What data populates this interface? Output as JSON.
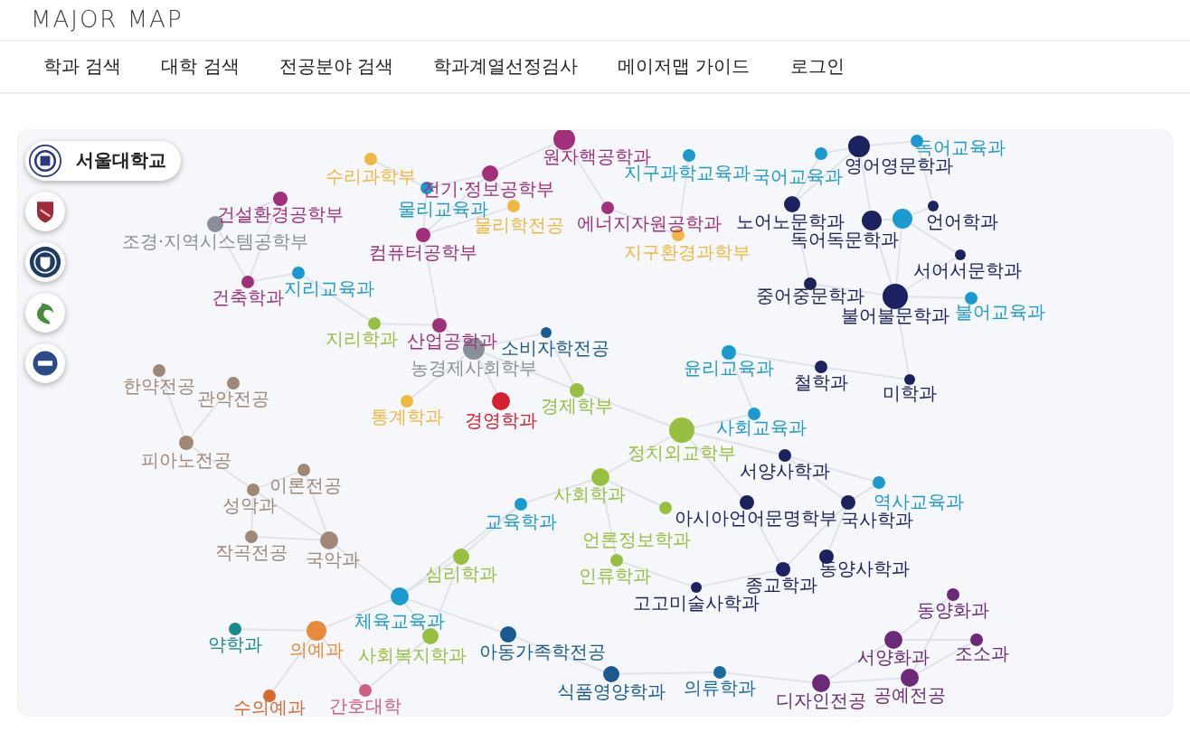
{
  "header": {
    "title": "MAJOR MAP"
  },
  "nav": [
    {
      "label": "학과 검색"
    },
    {
      "label": "대학 검색"
    },
    {
      "label": "전공분야 검색"
    },
    {
      "label": "학과계열선정검사"
    },
    {
      "label": "메이저맵 가이드"
    },
    {
      "label": "로그인"
    }
  ],
  "universities": [
    {
      "name": "서울대학교",
      "selected": true
    },
    {
      "selected": false
    },
    {
      "selected": false
    },
    {
      "selected": false
    },
    {
      "selected": false
    }
  ],
  "nodes": [
    {
      "label": "수리과학부",
      "color": "#f0b840"
    },
    {
      "label": "원자핵공학과",
      "color": "#a0307a"
    },
    {
      "label": "전기·정보공학부",
      "color": "#a0307a"
    },
    {
      "label": "물리교육과",
      "color": "#1a9ad0"
    },
    {
      "label": "물리학전공",
      "color": "#f0b840"
    },
    {
      "label": "지구과학교육과",
      "color": "#1a9ad0"
    },
    {
      "label": "에너지자원공학과",
      "color": "#a0307a"
    },
    {
      "label": "국어교육과",
      "color": "#1a9ad0"
    },
    {
      "label": "독어교육과",
      "color": "#1a9ad0"
    },
    {
      "label": "영어영문학과",
      "color": "#1c2260"
    },
    {
      "label": "건설환경공학부",
      "color": "#a0307a"
    },
    {
      "label": "조경·지역시스템공학부",
      "color": "#8a9098"
    },
    {
      "label": "컴퓨터공학부",
      "color": "#a0307a"
    },
    {
      "label": "지구환경과학부",
      "color": "#f0b840"
    },
    {
      "label": "노어노문학과",
      "color": "#1c2260"
    },
    {
      "label": "독어독문학과",
      "color": "#1c2260"
    },
    {
      "color": "#1a9ad0"
    },
    {
      "label": "언어학과",
      "color": "#1c2260"
    },
    {
      "label": "건축학과",
      "color": "#a0307a"
    },
    {
      "label": "지리교육과",
      "color": "#1a9ad0"
    },
    {
      "label": "서어서문학과",
      "color": "#1c2260"
    },
    {
      "label": "중어중문학과",
      "color": "#1c2260"
    },
    {
      "label": "불어불문학과",
      "color": "#1c2260"
    },
    {
      "label": "불어교육과",
      "color": "#1a9ad0"
    },
    {
      "label": "지리학과",
      "color": "#98c040"
    },
    {
      "label": "산업공학과",
      "color": "#a0307a"
    },
    {
      "label": "농경제사회학부",
      "color": "#8a9098"
    },
    {
      "label": "소비자학전공",
      "color": "#1a5a90"
    },
    {
      "label": "윤리교육과",
      "color": "#1a9ad0"
    },
    {
      "label": "철학과",
      "color": "#1c2260"
    },
    {
      "label": "미학과",
      "color": "#1c2260"
    },
    {
      "label": "한약전공",
      "color": "#a08878"
    },
    {
      "label": "관악전공",
      "color": "#a08878"
    },
    {
      "label": "통계학과",
      "color": "#f0b840"
    },
    {
      "label": "경영학과",
      "color": "#d42030"
    },
    {
      "label": "경제학부",
      "color": "#98c040"
    },
    {
      "label": "사회교육과",
      "color": "#1a9ad0"
    },
    {
      "label": "정치외교학부",
      "color": "#98c040"
    },
    {
      "label": "피아노전공",
      "color": "#a08878"
    },
    {
      "label": "서양사학과",
      "color": "#1c2260"
    },
    {
      "label": "이론전공",
      "color": "#a08878"
    },
    {
      "label": "성악과",
      "color": "#a08878"
    },
    {
      "label": "사회학과",
      "color": "#98c040"
    },
    {
      "label": "역사교육과",
      "color": "#1a9ad0"
    },
    {
      "label": "교육학과",
      "color": "#1a9ad0"
    },
    {
      "label": "아시아언어문명학부",
      "color": "#1c2260"
    },
    {
      "label": "국사학과",
      "color": "#1c2260"
    },
    {
      "label": "언론정보학과",
      "color": "#98c040"
    },
    {
      "label": "작곡전공",
      "color": "#a08878"
    },
    {
      "label": "국악과",
      "color": "#a08878"
    },
    {
      "label": "심리학과",
      "color": "#98c040"
    },
    {
      "label": "인류학과",
      "color": "#98c040"
    },
    {
      "label": "동양사학과",
      "color": "#1c2260"
    },
    {
      "label": "종교학과",
      "color": "#1c2260"
    },
    {
      "label": "고고미술사학과",
      "color": "#1c2260"
    },
    {
      "label": "체육교육과",
      "color": "#1a9ad0"
    },
    {
      "label": "동양화과",
      "color": "#6a2a78"
    },
    {
      "label": "약학과",
      "color": "#188a8a"
    },
    {
      "label": "의예과",
      "color": "#e88a3a"
    },
    {
      "label": "사회복지학과",
      "color": "#98c040"
    },
    {
      "label": "아동가족학전공",
      "color": "#1a5a90"
    },
    {
      "label": "서양화과",
      "color": "#6a2a78"
    },
    {
      "label": "조소과",
      "color": "#6a2a78"
    },
    {
      "label": "식품영양학과",
      "color": "#1a5a90"
    },
    {
      "label": "의류학과",
      "color": "#1a6aa0"
    },
    {
      "label": "디자인전공",
      "color": "#6a2a78"
    },
    {
      "label": "공예전공",
      "color": "#6a2a78"
    },
    {
      "label": "수의예과",
      "color": "#d86a30"
    },
    {
      "label": "간호대학",
      "color": "#d06080"
    }
  ]
}
